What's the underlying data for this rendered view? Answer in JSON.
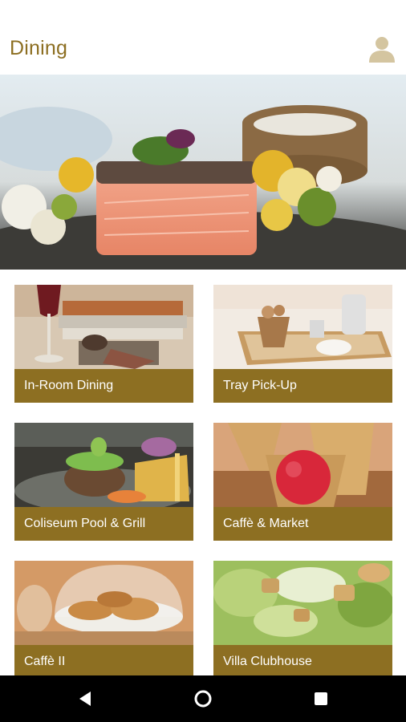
{
  "header": {
    "title": "Dining",
    "profile_icon": "person-icon"
  },
  "hero": {
    "image": "salmon-dish-photo"
  },
  "tiles": [
    {
      "label": "In-Room Dining",
      "image": "wine-and-books-photo"
    },
    {
      "label": "Tray Pick-Up",
      "image": "breakfast-tray-photo"
    },
    {
      "label": "Coliseum Pool & Grill",
      "image": "burger-and-fries-photo"
    },
    {
      "label": "Caffè & Market",
      "image": "gelato-cone-photo"
    },
    {
      "label": "Caffè II",
      "image": "pastries-under-glass-photo"
    },
    {
      "label": "Villa Clubhouse",
      "image": "caesar-salad-photo"
    }
  ],
  "navbar": {
    "back": "back-triangle-icon",
    "home": "home-circle-icon",
    "recents": "recents-square-icon"
  },
  "colors": {
    "accent": "#8d6f22",
    "navbar": "#000000",
    "avatar": "#d4c5a0"
  }
}
